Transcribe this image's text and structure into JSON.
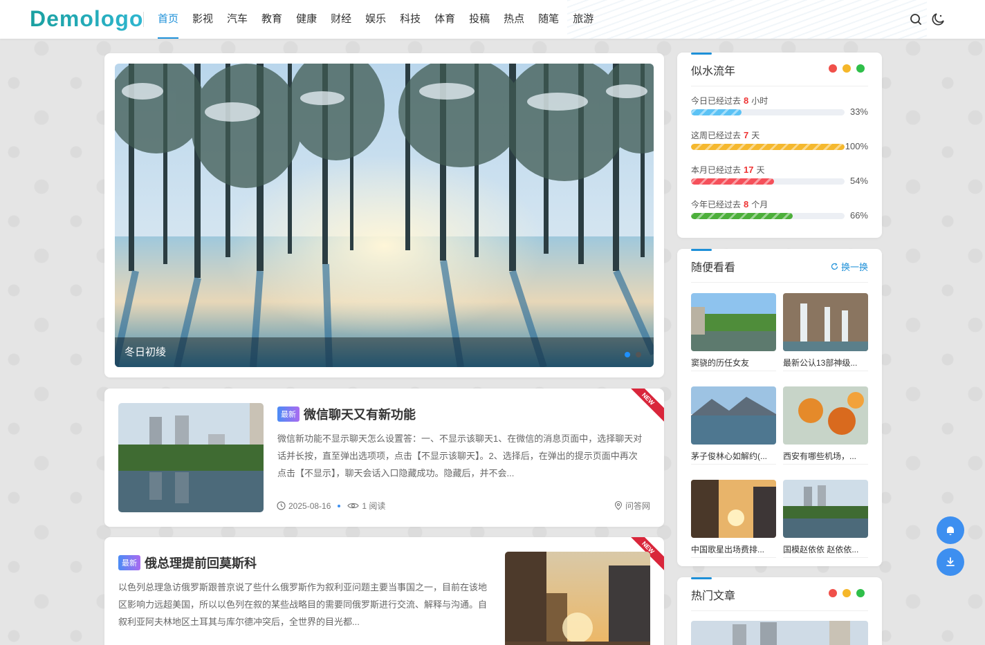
{
  "header": {
    "logo": "Demologo",
    "nav": [
      "首页",
      "影视",
      "汽车",
      "教育",
      "健康",
      "财经",
      "娱乐",
      "科技",
      "体育",
      "投稿",
      "热点",
      "随笔",
      "旅游"
    ],
    "active_index": 0
  },
  "slider": {
    "caption": "冬日初绫"
  },
  "posts": [
    {
      "badge": "最新",
      "title": "微信聊天又有新功能",
      "ribbon": "NEW",
      "excerpt": "微信新功能不显示聊天怎么设置答：一、不显示该聊天1、在微信的消息页面中，选择聊天对话并长按，直至弹出选项项，点击【不显示该聊天】。2、选择后，在弹出的提示页面中再次点击【不显示】，聊天会话入口隐藏成功。隐藏后，并不会...",
      "date": "2025-08-16",
      "reads": "1 阅读",
      "category": "问答网"
    },
    {
      "badge": "最新",
      "title": "俄总理提前回莫斯科",
      "ribbon": "NEW",
      "excerpt": "以色列总理急访俄罗斯跟普京说了些什么俄罗斯作为叙利亚问题主要当事国之一，目前在该地区影响力远超美国，所以以色列在叙的某些战略目的需要同俄罗斯进行交流、解释与沟通。自叙利亚阿夫林地区土耳其与库尔德冲突后，全世界的目光都..."
    }
  ],
  "time_widget": {
    "title": "似水流年",
    "rows": [
      {
        "prefix": "今日已经过去",
        "value": "8",
        "unit": "小时",
        "percent": "33%",
        "fill": 0.33,
        "color": "#5bc2f5"
      },
      {
        "prefix": "这周已经过去",
        "value": "7",
        "unit": "天",
        "percent": "100%",
        "fill": 1.0,
        "color": "#f5b82e"
      },
      {
        "prefix": "本月已经过去",
        "value": "17",
        "unit": "天",
        "percent": "54%",
        "fill": 0.54,
        "color": "#f5505a"
      },
      {
        "prefix": "今年已经过去",
        "value": "8",
        "unit": "个月",
        "percent": "66%",
        "fill": 0.66,
        "color": "#4caf3a"
      }
    ]
  },
  "random_widget": {
    "title": "随便看看",
    "refresh": "换一换",
    "items": [
      "窦骁的历任女友",
      "最新公认13部神级...",
      "茅子俊林心如解约(...",
      "西安有哪些机场，...",
      "中国歌星出场费排...",
      "国模赵依依 赵依依..."
    ]
  },
  "hot_widget": {
    "title": "热门文章"
  },
  "colors": {
    "accent": "#1e90d8",
    "dot_red": "#f0504a",
    "dot_yellow": "#f5b72a",
    "dot_green": "#2fbf4a",
    "float": "#3d8ff0"
  }
}
